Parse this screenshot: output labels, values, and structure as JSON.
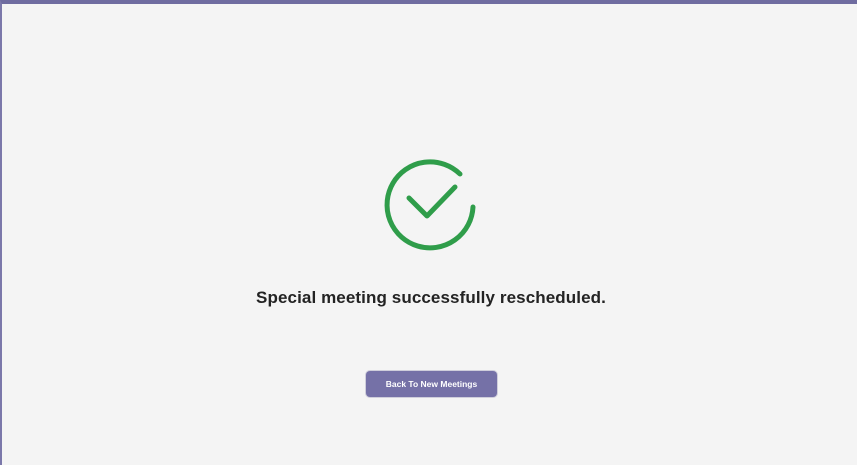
{
  "main": {
    "message": "Special meeting successfully rescheduled.",
    "button_label": "Back To New Meetings",
    "icon": "check-circle-icon"
  },
  "colors": {
    "background": "#f4f4f4",
    "accent": "#7571a7",
    "success": "#2f9d4a",
    "border": "#7b78aa"
  }
}
